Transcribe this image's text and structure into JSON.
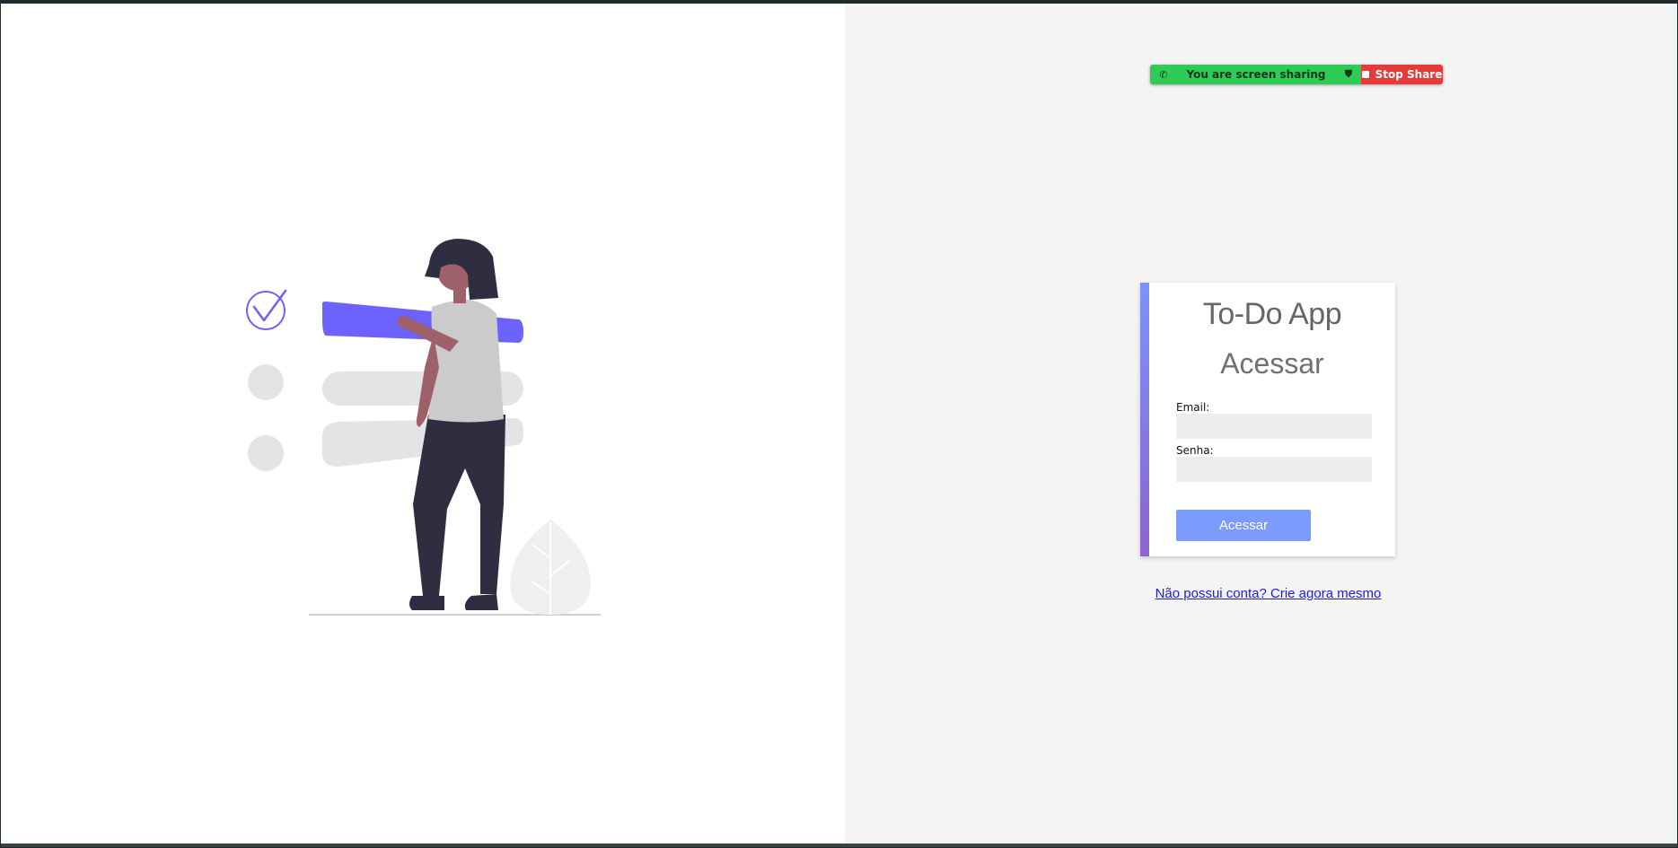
{
  "share_banner": {
    "status_text": "You are screen sharing",
    "stop_label": "Stop Share",
    "status_color": "#2ecc55",
    "stop_color": "#e43a3a"
  },
  "login": {
    "app_title": "To-Do App",
    "heading": "Acessar",
    "email_label": "Email:",
    "email_value": "",
    "password_label": "Senha:",
    "password_value": "",
    "submit_label": "Acessar",
    "signup_link": "Não possui conta? Crie agora mesmo",
    "accent_color": "#7b93ff",
    "button_color": "#7c9bff"
  },
  "illustration": {
    "description_icons": [
      "checkmark-circle-icon",
      "todo-bar",
      "person",
      "plant"
    ],
    "accent_color": "#6c63ff"
  }
}
